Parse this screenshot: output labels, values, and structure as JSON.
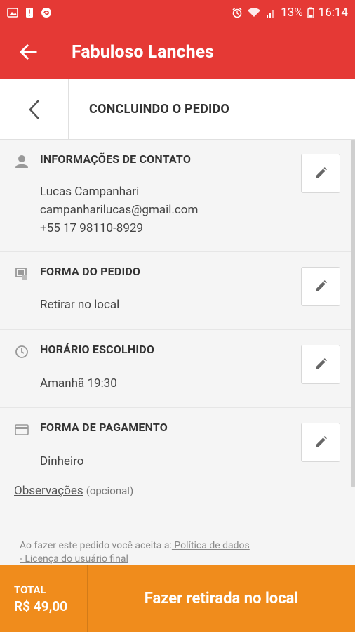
{
  "status_bar": {
    "battery_percent": "13%",
    "time": "16:14",
    "icons": [
      "image-icon",
      "alert-icon",
      "app-icon",
      "alarm-icon",
      "wifi-icon",
      "signal-icon",
      "battery-icon"
    ]
  },
  "app_bar": {
    "title": "Fabuloso Lanches",
    "back_icon": "arrow-back-icon"
  },
  "sub_header": {
    "title": "CONCLUINDO O PEDIDO",
    "back_icon": "chevron-left-icon"
  },
  "sections": {
    "contact": {
      "title": "INFORMAÇÕES DE CONTATO",
      "name": "Lucas Campanhari",
      "email": "campanharilucas@gmail.com",
      "phone": "+55 17 98110-8929",
      "icon": "person-icon"
    },
    "order_type": {
      "title": "FORMA DO PEDIDO",
      "value": "Retirar no local",
      "icon": "pickup-icon"
    },
    "schedule": {
      "title": "HORÁRIO ESCOLHIDO",
      "value": "Amanhã 19:30",
      "icon": "clock-icon"
    },
    "payment": {
      "title": "FORMA DE PAGAMENTO",
      "value": "Dinheiro",
      "icon": "card-icon"
    }
  },
  "observations": {
    "link_text": "Observações",
    "optional_text": "(opcional)"
  },
  "terms": {
    "prefix": "Ao fazer este pedido você aceita a:",
    "privacy_link": " Política de dados",
    "license_link": "- Licença do usuário final"
  },
  "footer": {
    "total_label": "TOTAL",
    "total_value": "R$ 49,00",
    "cta_label": "Fazer retirada no local"
  },
  "colors": {
    "primary_red": "#e53935",
    "accent_orange": "#f08c1c"
  }
}
